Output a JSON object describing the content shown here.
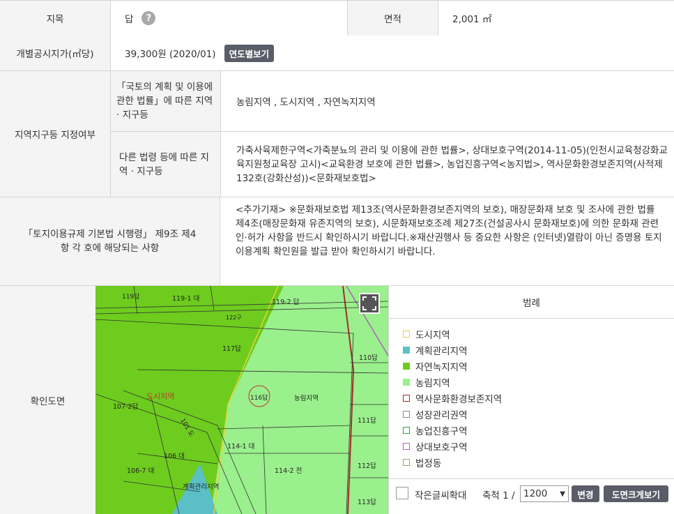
{
  "row1": {
    "label_jimok": "지목",
    "jimok_value": "답",
    "help_icon": "?",
    "label_area": "면적",
    "area_value": "2,001 ㎡"
  },
  "row2": {
    "label": "개별공시지가(㎡당)",
    "value": "39,300원 (2020/01)",
    "button": "연도별보기"
  },
  "zoning": {
    "label": "지역지구등 지정여부",
    "sub1_label": "「국토의 계획 및 이용에 관한 법률」에 따른 지역 · 지구등",
    "sub1_value": "농림지역 , 도시지역 , 자연녹지지역",
    "sub2_label": "다른 법령 등에 따른 지역 · 지구등",
    "sub2_value": "가축사육제한구역<가축분뇨의 관리 및 이용에 관한 법률>, 상대보호구역(2014-11-05)(인천시교육청강화교육지원청교육장 고시)<교육환경 보호에 관한 법률>, 농업진흥구역<농지법>, 역사문화환경보존지역(사적제132호(강화산성))<문화재보호법>"
  },
  "regulation": {
    "label": "「토지이용규제 기본법 시행령」 제9조 제4항 각 호에 해당되는 사항",
    "value": "<추가기재> ※문화재보호법 제13조(역사문화환경보존지역의 보호), 매장문화재 보호 및 조사에 관한 법률 제4조(매장문화재 유존지역의 보호), 시문화재보호조례 제27조(건설공사시 문화재보호)에 의한 문화재 관련 인·허가 사항을 반드시 확인하시기 바랍니다.※재산권행사 등 중요한 사항은 (인터넷)열람이 아닌 증명용 토지이용계획 확인원을 발급 받아 확인하시기 바랍니다."
  },
  "map_section": {
    "label": "확인도면",
    "map_labels": {
      "p119": "119답",
      "p119_1": "119-1 대",
      "p119_2": "119-2 답",
      "p122": "122구",
      "p117": "117답",
      "p110": "110답",
      "zone_city": "도시지역",
      "p116": "116답",
      "zone_farm": "농림지역",
      "p107_2": "107-2답",
      "p111": "111답",
      "p114_1": "114-1 대",
      "p106": "106 대",
      "p106_7": "106-7 대",
      "p114_2": "114-2 전",
      "p112": "112답",
      "zone_plan": "계획관리지역",
      "p113": "113답",
      "road": "101 도"
    },
    "legend_title": "범례",
    "legend": [
      {
        "label": "도시지역",
        "color": "#e6d23a",
        "fill": "none"
      },
      {
        "label": "계획관리지역",
        "color": "#5bbfc8",
        "fill": "#5bbfc8"
      },
      {
        "label": "자연녹지지역",
        "color": "#6dcc1e",
        "fill": "#6dcc1e"
      },
      {
        "label": "농림지역",
        "color": "#9af08c",
        "fill": "#9af08c"
      },
      {
        "label": "역사문화환경보존지역",
        "color": "#a52a2a",
        "fill": "none"
      },
      {
        "label": "성장관리권역",
        "color": "#8c8c8c",
        "fill": "none"
      },
      {
        "label": "농업진흥구역",
        "color": "#2e9e3e",
        "fill": "none"
      },
      {
        "label": "상대보호구역",
        "color": "#b060c0",
        "fill": "none"
      },
      {
        "label": "법정동",
        "color": "#b09a70",
        "fill": "none"
      }
    ],
    "large_text_label": "작은글씨확대",
    "scale_label": "축척 1 /",
    "scale_value": "1200",
    "change_button": "변경",
    "enlarge_button": "도면크게보기"
  }
}
